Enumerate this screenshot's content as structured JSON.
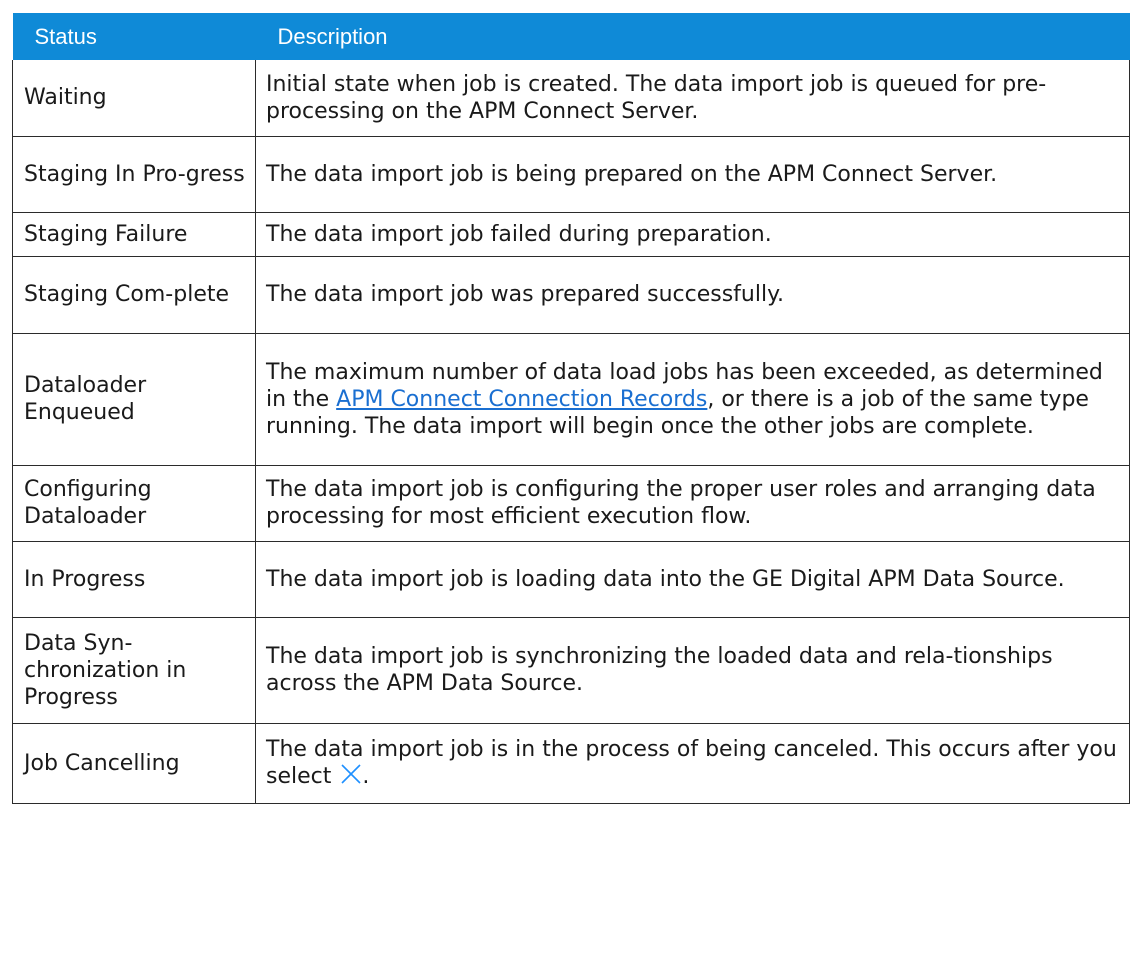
{
  "table": {
    "headers": {
      "status": "Status",
      "description": "Description"
    },
    "rows": [
      {
        "status": "Waiting",
        "description": "Initial state when job is created. The data import job is queued for pre-processing on the APM Connect Server."
      },
      {
        "status": "Staging In Pro-gress",
        "description": "The data import job is being prepared on the APM Connect Server."
      },
      {
        "status": "Staging Failure",
        "description": "The data import job failed during preparation."
      },
      {
        "status": "Staging Com-plete",
        "description": "The data import job was prepared successfully."
      },
      {
        "status": "Dataloader Enqueued",
        "description_before": "The maximum number of data load jobs has been exceeded, as determined in the ",
        "description_link": "APM Connect Connection Records",
        "description_after": ", or there is a job of the same type running. The data import will begin once the other jobs are complete."
      },
      {
        "status": "Configuring Dataloader",
        "description": "The data import job is configuring the proper user roles and arranging data processing for most efficient execution flow."
      },
      {
        "status": "In Progress",
        "description": "The data import job is loading data into the GE Digital APM Data Source."
      },
      {
        "status": "Data Syn-chronization in Progress",
        "description": "The data import job is synchronizing the loaded data and rela-tionships across the APM Data Source."
      },
      {
        "status": "Job Cancelling",
        "description_before": "The data import job is in the process of being canceled. This occurs after you select ",
        "description_icon": "close-x-icon",
        "description_after": "."
      }
    ]
  },
  "colors": {
    "header_bg": "#0f8ad7",
    "header_text": "#ffffff",
    "link": "#1a6fd1",
    "icon": "#1e90ff"
  }
}
